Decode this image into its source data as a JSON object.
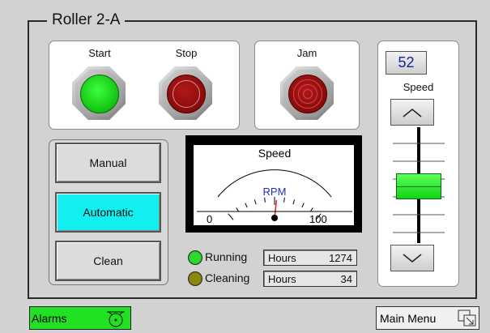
{
  "group": {
    "title": "Roller 2-A"
  },
  "controls": {
    "start_label": "Start",
    "stop_label": "Stop",
    "jam_label": "Jam",
    "start_lamp_color": "#19e019",
    "stop_lamp_color": "#8a0a0a",
    "jam_lamp_color": "#8a0a0a"
  },
  "modes": {
    "items": [
      {
        "label": "Manual",
        "active": false
      },
      {
        "label": "Automatic",
        "active": true
      },
      {
        "label": "Clean",
        "active": false
      }
    ],
    "active_color": "#13eef0"
  },
  "meter": {
    "title": "Speed",
    "unit": "RPM",
    "min": "0",
    "max": "100",
    "needle_value": 52
  },
  "status": {
    "running": {
      "label": "Running",
      "hours_label": "Hours",
      "hours_value": "1274",
      "lamp_color": "#2fd82f"
    },
    "cleaning": {
      "label": "Cleaning",
      "hours_label": "Hours",
      "hours_value": "34",
      "lamp_color": "#8a8a10"
    }
  },
  "speed": {
    "value": "52",
    "label": "Speed",
    "slider_level": 0.52
  },
  "footer": {
    "alarms_label": "Alarms",
    "main_menu_label": "Main Menu",
    "alarms_color": "#22e022"
  },
  "icons": {
    "alarm": "alarm-bell-icon",
    "main_menu": "navigate-icon",
    "up": "chevron-up-icon",
    "down": "chevron-down-icon"
  }
}
